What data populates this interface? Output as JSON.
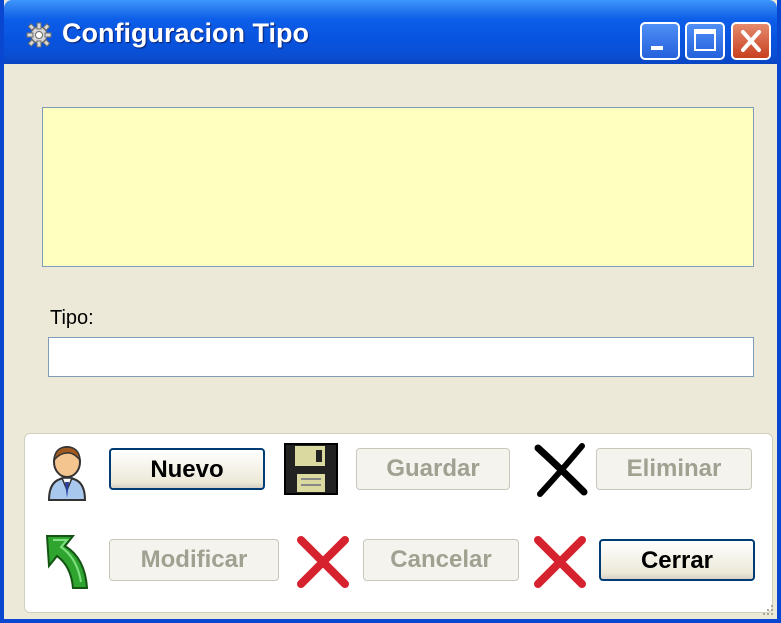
{
  "window": {
    "title": "Configuracion Tipo",
    "title_icon": "gear-icon",
    "controls": [
      "minimize",
      "maximize",
      "close"
    ]
  },
  "form": {
    "info_text": "",
    "tipo_label": "Tipo:",
    "tipo_value": ""
  },
  "buttons": {
    "nuevo": {
      "label": "Nuevo",
      "icon": "user-icon",
      "enabled": true
    },
    "guardar": {
      "label": "Guardar",
      "icon": "floppy-disk-icon",
      "enabled": false
    },
    "eliminar": {
      "label": "Eliminar",
      "icon": "delete-x-icon",
      "enabled": false
    },
    "modificar": {
      "label": "Modificar",
      "icon": "green-arrow-icon",
      "enabled": false
    },
    "cancelar": {
      "label": "Cancelar",
      "icon": "red-x-icon",
      "enabled": false
    },
    "cerrar": {
      "label": "Cerrar",
      "icon": "red-x-icon",
      "enabled": true
    }
  },
  "colors": {
    "titlebar": "#0854e0",
    "info_area_bg": "#ffffc0",
    "window_bg": "#ece9d8",
    "close_button": "#c8401e"
  }
}
